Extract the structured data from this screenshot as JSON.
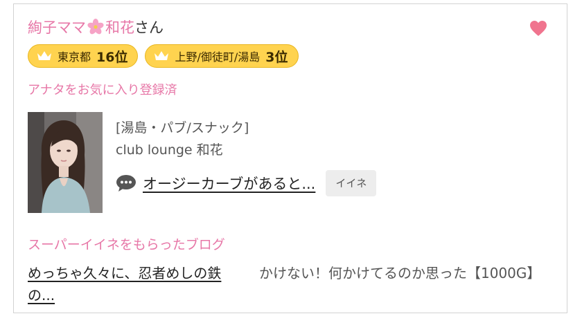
{
  "user": {
    "name_part1": "絢子ママ",
    "name_emoji": "cherry-blossom",
    "name_part2": "和花",
    "honorific": "さん"
  },
  "favorite_icon": "heart-icon",
  "rankings": [
    {
      "area": "東京都",
      "rank": "16位"
    },
    {
      "area": "上野/御徒町/湯島",
      "rank": "3位"
    }
  ],
  "favorite_status": "アナタをお気に入り登録済",
  "shop": {
    "category": "[湯島・パブ/スナック]",
    "name": "club lounge 和花"
  },
  "comment": {
    "icon": "speech-bubble-icon",
    "text": "オージーカーブがあると...",
    "iine_label": "イイネ"
  },
  "super_iine": {
    "title": "スーパーイイネをもらったブログ",
    "blog_title": "めっちゃ久々に、忍者めしの鉄の...",
    "blog_excerpt": "かけない！何かけてるのか思った【1000G】"
  },
  "colors": {
    "pink": "#e777a7",
    "badge_yellow": "#ffd34f",
    "heart": "#f0748e"
  }
}
